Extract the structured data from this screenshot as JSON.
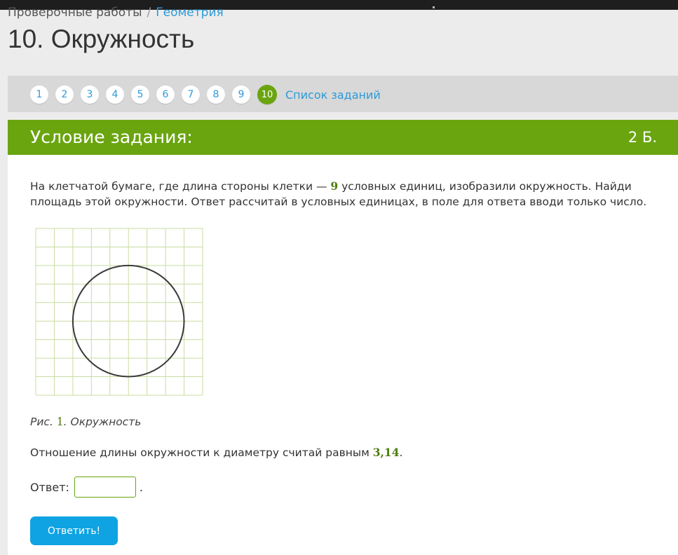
{
  "breadcrumb": {
    "parent": "Проверочные работы",
    "separator": "/",
    "current": "Геометрия"
  },
  "page_title": "10. Окружность",
  "pager": {
    "pages": [
      "1",
      "2",
      "3",
      "4",
      "5",
      "6",
      "7",
      "8",
      "9",
      "10"
    ],
    "active_page": "10",
    "task_list_label": "Список заданий"
  },
  "task": {
    "header_title": "Условие задания:",
    "points": "2 Б.",
    "text_part1": "На клетчатой бумаге, где длина стороны клетки — ",
    "cell_size": "9",
    "text_part2": " условных единиц, изобразили окружность. Найди площадь этой окружности. Ответ рассчитай в условных единицах, в поле для ответа вводи только число.",
    "figure": {
      "grid_cells": 9,
      "circle_radius_cells": 3,
      "grid_color": "#c8dca0",
      "circle_color": "#3a3a3a"
    },
    "caption_prefix": "Рис. ",
    "caption_number": "1",
    "caption_suffix": ". Окружность",
    "ratio_text": "Отношение длины окружности к диаметру считай равным ",
    "pi_value": "3,14",
    "ratio_end": "."
  },
  "answer": {
    "label": "Ответ:",
    "value": "",
    "suffix": "."
  },
  "submit_label": "Ответить!",
  "colors": {
    "accent_green": "#6aa50f",
    "link_blue": "#2c9ad8",
    "button_blue": "#0fa3e3"
  }
}
